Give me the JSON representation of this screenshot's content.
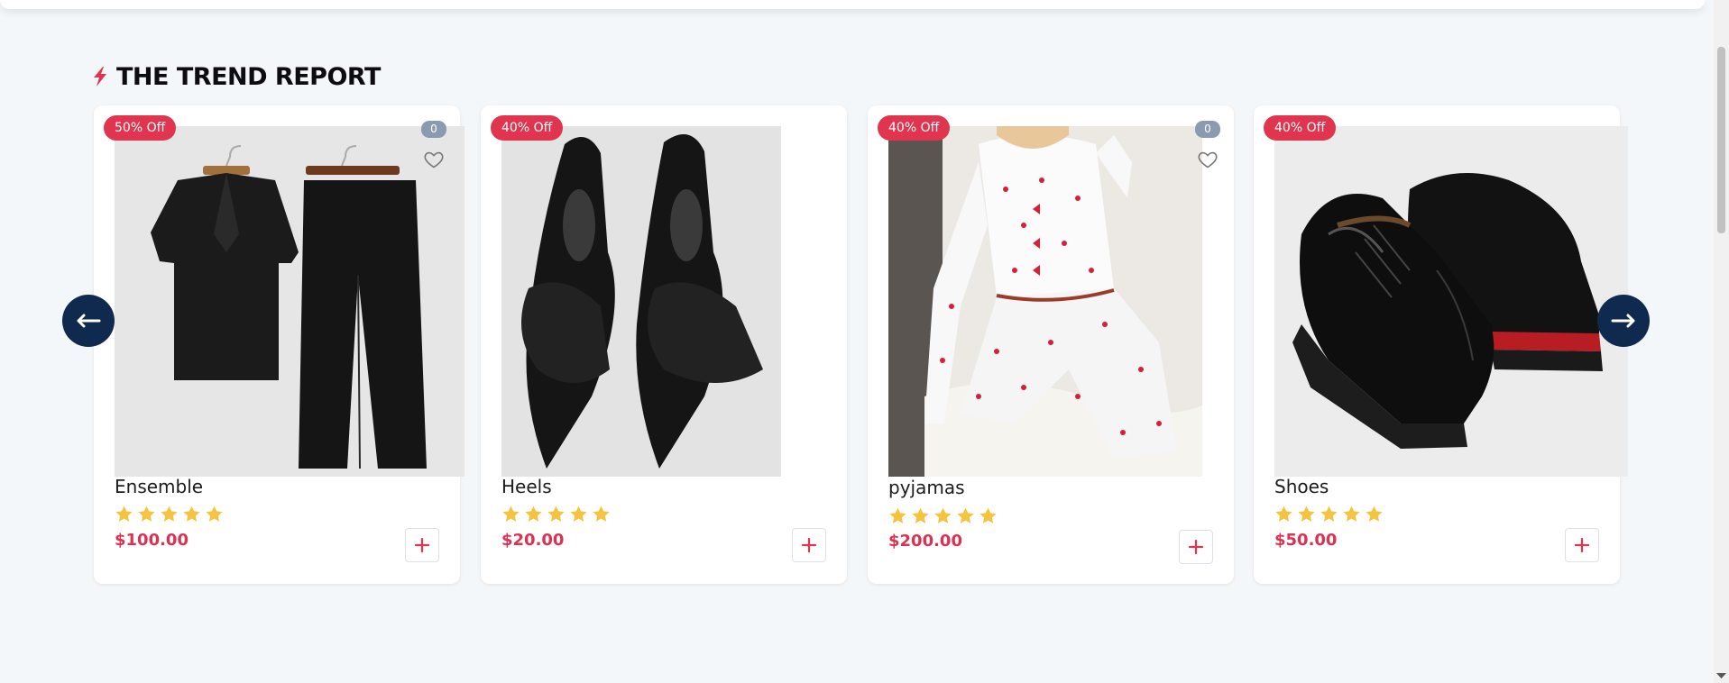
{
  "section": {
    "title": "THE TREND REPORT",
    "icon": "lightning-bolt-icon"
  },
  "colors": {
    "accent": "#e1344f",
    "navy": "#0f2a4e",
    "star": "#f6c33f",
    "price": "#dc3151"
  },
  "carousel": {
    "prev_icon": "arrow-left-icon",
    "next_icon": "arrow-right-icon",
    "products": [
      {
        "name": "Ensemble",
        "price": "$100.00",
        "discount": "50% Off",
        "wishlist_count": "0",
        "rating": 5
      },
      {
        "name": "Heels",
        "price": "$20.00",
        "discount": "40% Off",
        "rating": 5
      },
      {
        "name": "pyjamas",
        "price": "$200.00",
        "discount": "40% Off",
        "wishlist_count": "0",
        "rating": 5
      },
      {
        "name": "Shoes",
        "price": "$50.00",
        "discount": "40% Off",
        "rating": 5
      }
    ]
  }
}
